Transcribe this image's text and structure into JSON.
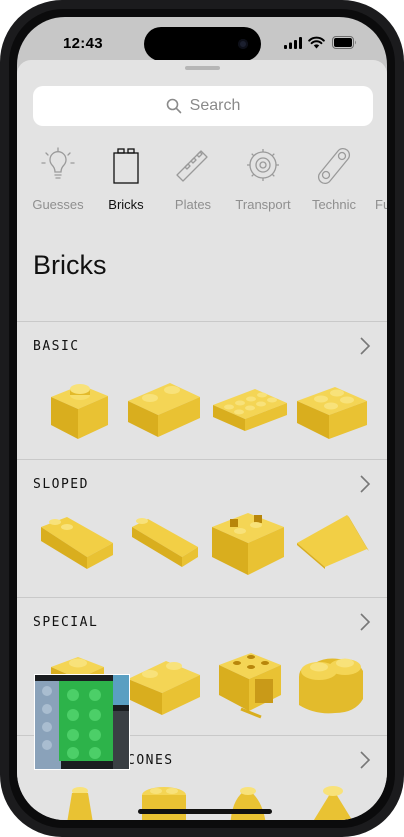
{
  "status_bar": {
    "time": "12:43"
  },
  "search": {
    "placeholder": "Search"
  },
  "categories": [
    {
      "label": "Guesses",
      "icon": "lightbulb-icon"
    },
    {
      "label": "Bricks",
      "icon": "brick-icon",
      "active": true
    },
    {
      "label": "Plates",
      "icon": "plate-icon"
    },
    {
      "label": "Transport",
      "icon": "gear-icon"
    },
    {
      "label": "Technic",
      "icon": "technic-icon"
    },
    {
      "label": "Fu",
      "icon": "more-icon"
    }
  ],
  "page": {
    "title": "Bricks"
  },
  "sections": [
    {
      "title": "BASIC"
    },
    {
      "title": "SLOPED"
    },
    {
      "title": "SPECIAL"
    },
    {
      "title": "CONES"
    }
  ],
  "colors": {
    "brick": "#E8C12E",
    "sheet": "#E3E3E3",
    "thumbnail_brick": "#2DB34A"
  }
}
